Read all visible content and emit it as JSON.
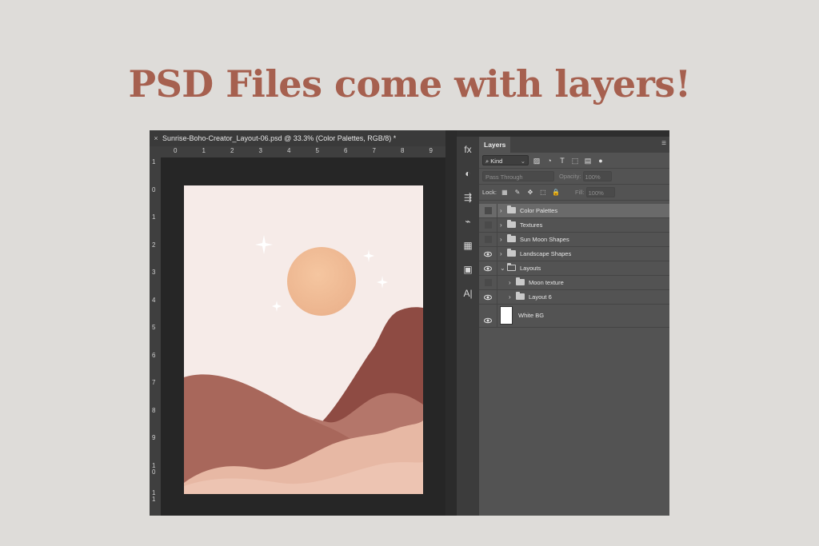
{
  "headline": "PSD Files come with layers!",
  "colors": {
    "headline": "#a6604f",
    "page_bg": "#dedcd9"
  },
  "document": {
    "tab_title": "Sunrise-Boho-Creator_Layout-06.psd @ 33.3% (Color Palettes, RGB/8) *",
    "close_glyph": "×",
    "ruler_top_labels": [
      "0",
      "1",
      "2",
      "3",
      "4",
      "5",
      "6",
      "7",
      "8",
      "9"
    ],
    "ruler_left_labels": [
      "1",
      "0",
      "1",
      "2",
      "3",
      "4",
      "5",
      "6",
      "7",
      "8",
      "9",
      "1 0",
      "1 1"
    ]
  },
  "tool_strip": {
    "icons": [
      "fx-icon",
      "adjustment-icon",
      "properties-icon",
      "paths-icon",
      "libraries-icon",
      "navigator-icon",
      "character-icon"
    ],
    "glyphs": [
      "fx",
      "◐",
      "⇶",
      "⌁",
      "▦",
      "▣",
      "A|"
    ],
    "collapse_glyph": "‹‹"
  },
  "layers_panel": {
    "tab_label": "Layers",
    "menu_glyph": "≡",
    "collapse_glyph": "››",
    "filter": {
      "kind_label": "Kind",
      "search_glyph": "⌕",
      "chevron_glyph": "⌄",
      "icon_glyphs": [
        "▨",
        "◔",
        "T",
        "⬚",
        "▤",
        "●"
      ]
    },
    "blend_mode": "Pass Through",
    "opacity_label": "Opacity:",
    "opacity_value": "100%",
    "lock_label": "Lock:",
    "lock_glyphs": [
      "▦",
      "✎",
      "✥",
      "⬚",
      "🔒"
    ],
    "fill_label": "Fill:",
    "fill_value": "100%",
    "layers": [
      {
        "name": "Color Palettes",
        "type": "group",
        "visible": false,
        "selected": true,
        "expanded": false,
        "indent": 0
      },
      {
        "name": "Textures",
        "type": "group",
        "visible": false,
        "selected": false,
        "expanded": false,
        "indent": 0
      },
      {
        "name": "Sun Moon Shapes",
        "type": "group",
        "visible": false,
        "selected": false,
        "expanded": false,
        "indent": 0
      },
      {
        "name": "Landscape Shapes",
        "type": "group",
        "visible": true,
        "selected": false,
        "expanded": false,
        "indent": 0
      },
      {
        "name": "Layouts",
        "type": "group",
        "visible": true,
        "selected": false,
        "expanded": true,
        "indent": 0
      },
      {
        "name": "Moon texture",
        "type": "group",
        "visible": false,
        "selected": false,
        "expanded": false,
        "indent": 1
      },
      {
        "name": "Layout 6",
        "type": "group",
        "visible": true,
        "selected": false,
        "expanded": false,
        "indent": 1
      },
      {
        "name": "White BG",
        "type": "layer",
        "visible": true,
        "selected": false,
        "expanded": false,
        "indent": 0
      }
    ]
  }
}
